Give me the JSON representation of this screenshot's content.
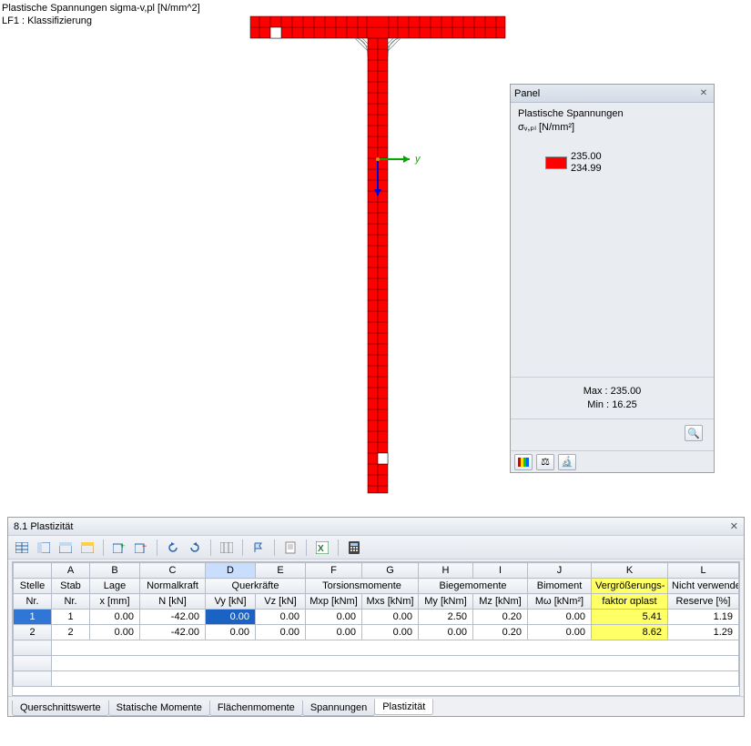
{
  "overlay": {
    "line1": "Plastische Spannungen sigma-v,pl [N/mm^2]",
    "line2": "LF1 : Klassifizierung"
  },
  "axis_y_label": "y",
  "legend_panel": {
    "title": "Panel",
    "heading": "Plastische Spannungen",
    "subheading": "σᵥ,ₚₗ [N/mm²]",
    "scale_high": "235.00",
    "scale_low": "234.99",
    "max_label": "Max  :",
    "max_value": "235.00",
    "min_label": "Min   :",
    "min_value": "16.25"
  },
  "bottom_window": {
    "title": "8.1 Plastizität",
    "col_letters": [
      "A",
      "B",
      "C",
      "D",
      "E",
      "F",
      "G",
      "H",
      "I",
      "J",
      "K",
      "L"
    ],
    "header_row1": [
      "Stelle",
      "Stab",
      "Lage",
      "Normalkraft",
      "Querkräfte",
      "",
      "Torsionsmomente",
      "",
      "Biegemomente",
      "",
      "Bimoment",
      "Vergrößerungs-",
      "Nicht verwendete"
    ],
    "header_row2": [
      "Nr.",
      "Nr.",
      "x [mm]",
      "N [kN]",
      "Vy [kN]",
      "Vz [kN]",
      "Mxp [kNm]",
      "Mxs [kNm]",
      "My [kNm]",
      "Mz [kNm]",
      "Mω [kNm²]",
      "faktor αplast",
      "Reserve [%]"
    ],
    "rows": [
      {
        "stelle": "1",
        "stab": "1",
        "x": "0.00",
        "n": "-42.00",
        "vy": "0.00",
        "vz": "0.00",
        "mxp": "0.00",
        "mxs": "0.00",
        "my": "2.50",
        "mz": "0.20",
        "mw": "0.00",
        "alpha": "5.41",
        "res": "1.19"
      },
      {
        "stelle": "2",
        "stab": "2",
        "x": "0.00",
        "n": "-42.00",
        "vy": "0.00",
        "vz": "0.00",
        "mxp": "0.00",
        "mxs": "0.00",
        "my": "0.00",
        "mz": "0.20",
        "mw": "0.00",
        "alpha": "8.62",
        "res": "1.29"
      }
    ],
    "tabs": [
      "Querschnittswerte",
      "Statische Momente",
      "Flächenmomente",
      "Spannungen",
      "Plastizität"
    ],
    "active_tab": 4
  }
}
